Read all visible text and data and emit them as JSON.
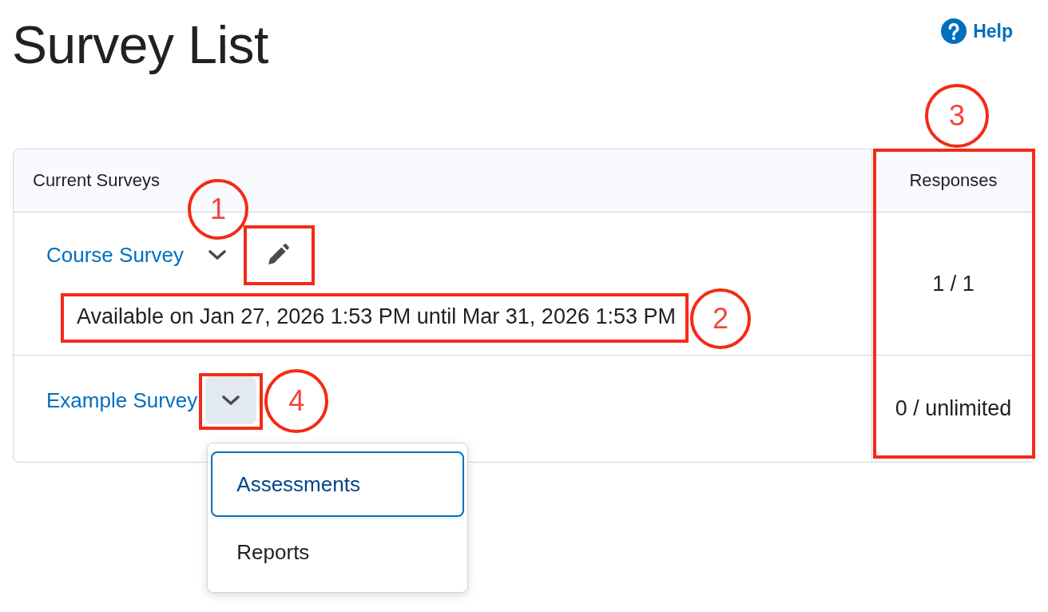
{
  "page": {
    "title": "Survey List",
    "help_link": "Help"
  },
  "table": {
    "columns": [
      {
        "label": "Current Surveys"
      },
      {
        "label": "Responses",
        "annotation": "3"
      }
    ],
    "rows": [
      {
        "name": "Course Survey",
        "menu_button": {
          "open": false
        },
        "edit_button": {
          "annotation": "1"
        },
        "availability": {
          "text": "Available on Jan 27, 2026 1:53 PM until Mar 31, 2026 1:53 PM",
          "annotation": "2"
        },
        "responses": "1 / 1"
      },
      {
        "name": "Example Survey",
        "menu_button": {
          "open": true,
          "annotation": "4",
          "menu": [
            {
              "label": "Assessments",
              "selected": true
            },
            {
              "label": "Reports",
              "selected": false
            }
          ]
        },
        "responses": "0 / unlimited"
      }
    ]
  }
}
